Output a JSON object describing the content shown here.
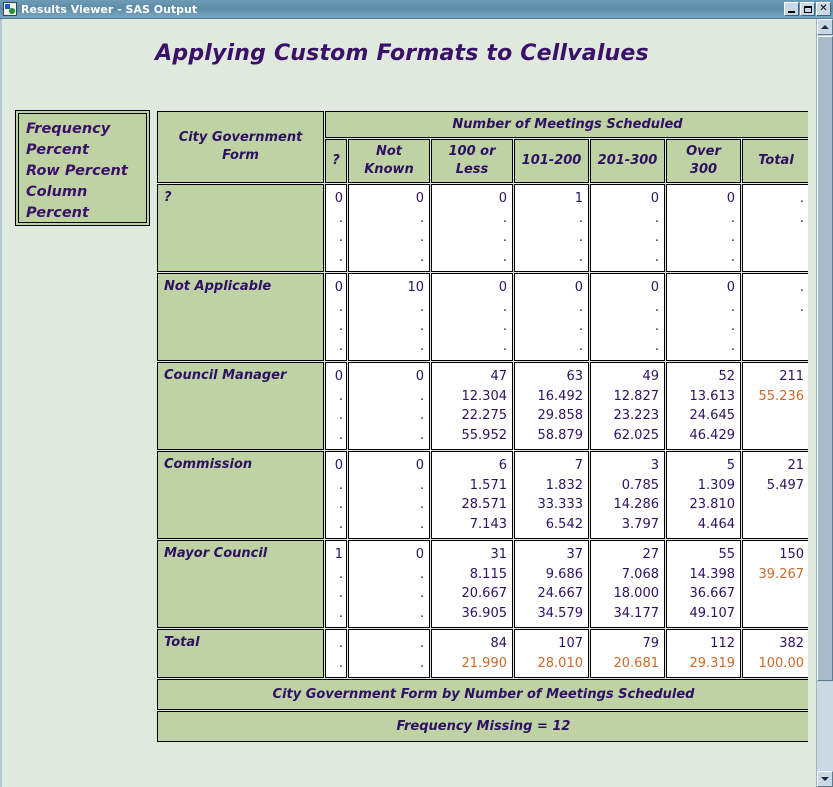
{
  "window": {
    "title": "Results Viewer - SAS Output",
    "icon": "sas-app-icon",
    "buttons": {
      "minimize": "_",
      "maximize": "□",
      "close": "×"
    }
  },
  "scrollbar": {
    "up_icon": "scroll-up-arrow",
    "down_icon": "scroll-down-arrow"
  },
  "report": {
    "title": "Applying Custom Formats to Cellvalues",
    "legend": [
      "Frequency",
      "Percent",
      "Row Percent",
      "Column Percent"
    ],
    "table": {
      "row_header_label": "City Government Form",
      "column_group_label": "Number of Meetings Scheduled",
      "column_headers": [
        "?",
        "Not Known",
        "100 or Less",
        "101-200",
        "201-300",
        "Over 300",
        "Total"
      ],
      "rows": [
        {
          "label": "?",
          "cells": [
            {
              "values": [
                "0",
                ".",
                ".",
                "."
              ]
            },
            {
              "values": [
                "0",
                ".",
                ".",
                "."
              ]
            },
            {
              "values": [
                "0",
                ".",
                ".",
                "."
              ]
            },
            {
              "values": [
                "1",
                ".",
                ".",
                "."
              ]
            },
            {
              "values": [
                "0",
                ".",
                ".",
                "."
              ]
            },
            {
              "values": [
                "0",
                ".",
                ".",
                "."
              ]
            },
            {
              "values": [
                ".",
                "."
              ]
            }
          ]
        },
        {
          "label": "Not Applicable",
          "cells": [
            {
              "values": [
                "0",
                ".",
                ".",
                "."
              ]
            },
            {
              "values": [
                "10",
                ".",
                ".",
                "."
              ]
            },
            {
              "values": [
                "0",
                ".",
                ".",
                "."
              ]
            },
            {
              "values": [
                "0",
                ".",
                ".",
                "."
              ]
            },
            {
              "values": [
                "0",
                ".",
                ".",
                "."
              ]
            },
            {
              "values": [
                "0",
                ".",
                ".",
                "."
              ]
            },
            {
              "values": [
                ".",
                "."
              ]
            }
          ]
        },
        {
          "label": "Council Manager",
          "cells": [
            {
              "values": [
                "0",
                ".",
                ".",
                "."
              ]
            },
            {
              "values": [
                "0",
                ".",
                ".",
                "."
              ]
            },
            {
              "values": [
                "47",
                "12.304",
                "22.275",
                "55.952"
              ]
            },
            {
              "values": [
                "63",
                "16.492",
                "29.858",
                "58.879"
              ]
            },
            {
              "values": [
                "49",
                "12.827",
                "23.223",
                "62.025"
              ]
            },
            {
              "values": [
                "52",
                "13.613",
                "24.645",
                "46.429"
              ]
            },
            {
              "values": [
                "211",
                "55.236"
              ],
              "accent_index": 1
            }
          ]
        },
        {
          "label": "Commission",
          "cells": [
            {
              "values": [
                "0",
                ".",
                ".",
                "."
              ]
            },
            {
              "values": [
                "0",
                ".",
                ".",
                "."
              ]
            },
            {
              "values": [
                "6",
                "1.571",
                "28.571",
                "7.143"
              ]
            },
            {
              "values": [
                "7",
                "1.832",
                "33.333",
                "6.542"
              ]
            },
            {
              "values": [
                "3",
                "0.785",
                "14.286",
                "3.797"
              ]
            },
            {
              "values": [
                "5",
                "1.309",
                "23.810",
                "4.464"
              ]
            },
            {
              "values": [
                "21",
                "5.497"
              ]
            }
          ]
        },
        {
          "label": "Mayor Council",
          "cells": [
            {
              "values": [
                "1",
                ".",
                ".",
                "."
              ]
            },
            {
              "values": [
                "0",
                ".",
                ".",
                "."
              ]
            },
            {
              "values": [
                "31",
                "8.115",
                "20.667",
                "36.905"
              ]
            },
            {
              "values": [
                "37",
                "9.686",
                "24.667",
                "34.579"
              ]
            },
            {
              "values": [
                "27",
                "7.068",
                "18.000",
                "34.177"
              ]
            },
            {
              "values": [
                "55",
                "14.398",
                "36.667",
                "49.107"
              ]
            },
            {
              "values": [
                "150",
                "39.267"
              ],
              "accent_index": 1
            }
          ]
        },
        {
          "label": "Total",
          "total_row": true,
          "cells": [
            {
              "values": [
                ".",
                "."
              ]
            },
            {
              "values": [
                ".",
                "."
              ]
            },
            {
              "values": [
                "84",
                "21.990"
              ],
              "accent_index": 1
            },
            {
              "values": [
                "107",
                "28.010"
              ],
              "accent_index": 1
            },
            {
              "values": [
                "79",
                "20.681"
              ],
              "accent_index": 1
            },
            {
              "values": [
                "112",
                "29.319"
              ],
              "accent_index": 1
            },
            {
              "values": [
                "382",
                "100.00"
              ],
              "accent_index": 1
            }
          ]
        }
      ],
      "caption": "City Government Form by Number of Meetings Scheduled",
      "note": "Frequency Missing = 12"
    }
  },
  "colors": {
    "header_bg": "#bed2a4",
    "text": "#3b1069",
    "accent": "#cd6a2a",
    "page_bg": "#dfe9de",
    "titlebar": "#5d8ca8"
  }
}
